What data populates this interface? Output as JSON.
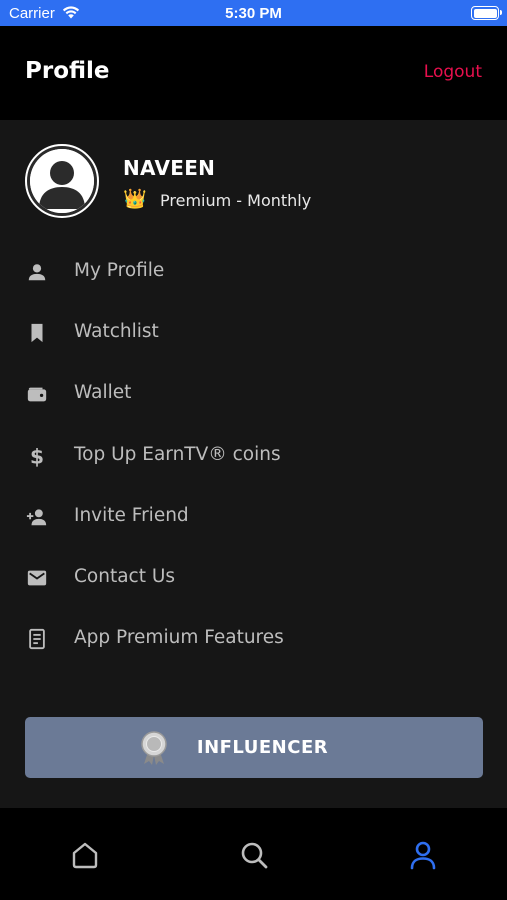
{
  "status_bar": {
    "carrier": "Carrier",
    "time": "5:30 PM"
  },
  "header": {
    "title": "Profile",
    "logout_label": "Logout"
  },
  "profile": {
    "name": "NAVEEN",
    "badge_icon": "👑",
    "plan": "Premium - Monthly"
  },
  "menu": [
    {
      "label": "My Profile",
      "icon": "person-icon"
    },
    {
      "label": "Watchlist",
      "icon": "bookmark-icon"
    },
    {
      "label": "Wallet",
      "icon": "wallet-icon"
    },
    {
      "label": "Top Up EarnTV® coins",
      "icon": "dollar-icon"
    },
    {
      "label": "Invite Friend",
      "icon": "add-person-icon"
    },
    {
      "label": "Contact Us",
      "icon": "mail-icon"
    },
    {
      "label": "App Premium Features",
      "icon": "document-icon"
    }
  ],
  "influencer_button": {
    "label": "INFLUENCER",
    "icon": "medal-icon"
  },
  "tabs": [
    {
      "name": "home",
      "icon": "home-icon",
      "active": false
    },
    {
      "name": "search",
      "icon": "search-icon",
      "active": false
    },
    {
      "name": "profile",
      "icon": "profile-icon",
      "active": true
    }
  ],
  "colors": {
    "status_bar": "#2e6ff2",
    "accent_logout": "#e8104e",
    "influencer_button": "#6b7a96",
    "active_tab": "#2f6ff0",
    "inactive_tab": "#bdbdbd"
  }
}
